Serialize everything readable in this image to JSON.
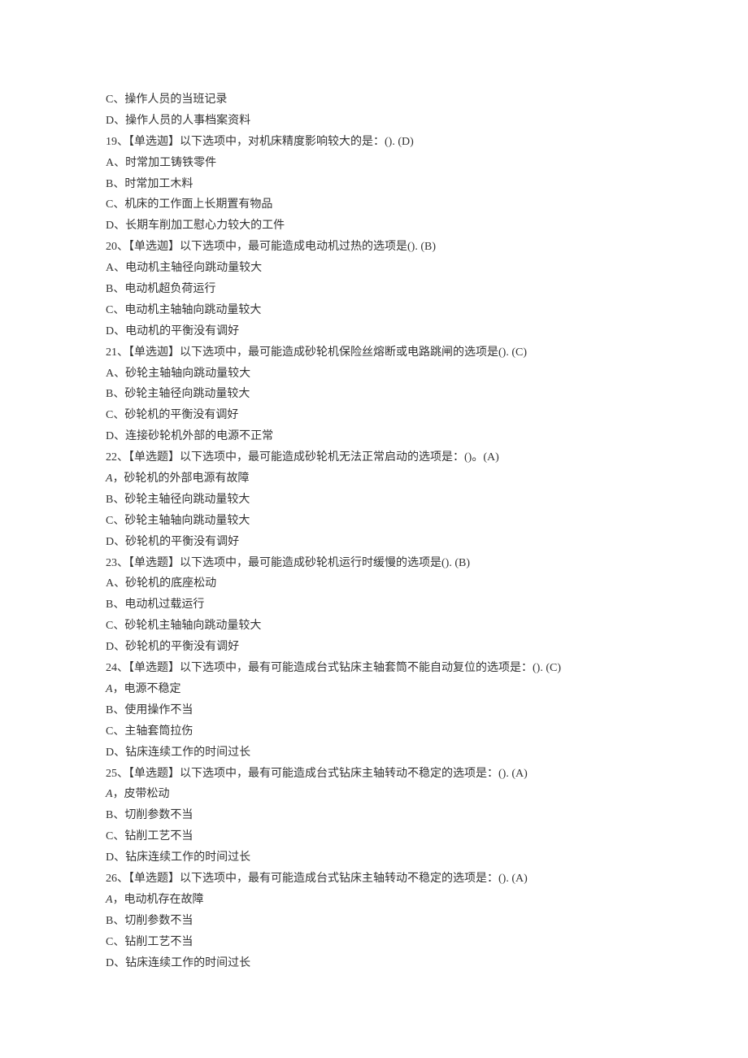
{
  "lines": [
    "C、操作人员的当班记录",
    "D、操作人员的人事档案资料",
    "19、【单选迦】以下选项中，对机床精度影响较大的是：(). (D)",
    "A、时常加工铸铁零件",
    "B、时常加工木料",
    "C、机床的工作面上长期置有物品",
    "D、长期车削加工慰心力较大的工件",
    "20、【单选迦】以下选项中，最可能造成电动机过热的选项是(). (B)",
    "A、电动机主轴径向跳动量较大",
    "B、电动机超负荷运行",
    "C、电动机主轴轴向跳动量较大",
    "D、电动机的平衡没有调好",
    "21、【单选迦】以下选项中，最可能造成砂轮机保险丝熔断或电路跳闸的选项是(). (C)",
    "A、砂轮主轴轴向跳动量较大",
    "B、砂轮主轴径向跳动量较大",
    "C、砂轮机的平衡没有调好",
    "D、连接砂轮机外部的电源不正常",
    "22、【单选题】以下选项中，最可能造成砂轮机无法正常启动的选项是：()。(A)",
    {
      "italicPrefix": "A",
      "rest": "，砂轮机的外部电源有故障"
    },
    "B、砂轮主轴径向跳动量较大",
    "C、砂轮主轴轴向跳动量较大",
    "D、砂轮机的平衡没有调好",
    "23、【单选题】以下选项中，最可能造成砂轮机运行时缓慢的选项是(). (B)",
    "A、砂轮机的底座松动",
    "B、电动机过载运行",
    "C、砂轮机主轴轴向跳动量较大",
    "D、砂轮机的平衡没有调好",
    "24、【单选题】以下选项中，最有可能造成台式钻床主轴套筒不能自动复位的选项是：(). (C)",
    {
      "italicPrefix": "A",
      "rest": "，电源不稳定"
    },
    "B、使用操作不当",
    "C、主轴套筒拉伤",
    "D、钻床连续工作的时间过长",
    "25、【单选题】以下选项中，最有可能造成台式钻床主轴转动不稳定的选项是：(). (A)",
    {
      "italicPrefix": "A",
      "rest": "，皮带松动"
    },
    "B、切削参数不当",
    "C、钻削工艺不当",
    "D、钻床连续工作的时间过长",
    "26、【单选题】以下选项中，最有可能造成台式钻床主轴转动不稳定的选项是：(). (A)",
    {
      "italicPrefix": "A",
      "rest": "，电动机存在故障"
    },
    "B、切削参数不当",
    "C、钻削工艺不当",
    "D、钻床连续工作的时间过长"
  ]
}
